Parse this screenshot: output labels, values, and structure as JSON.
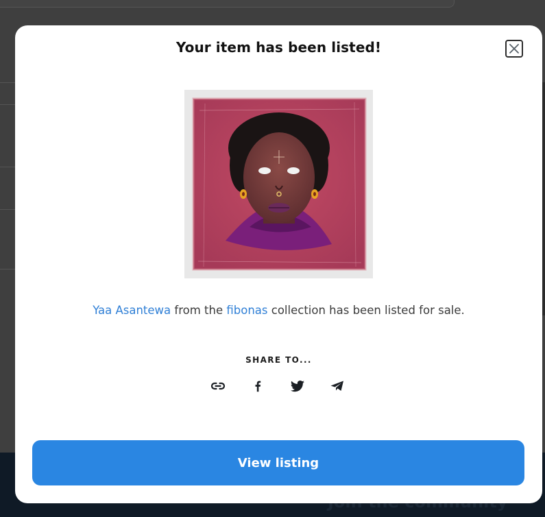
{
  "modal": {
    "title": "Your item has been listed!",
    "close_icon": "close-icon",
    "message": {
      "item_name": "Yaa Asantewa",
      "text_from": " from the ",
      "collection_name": "fibonas",
      "text_end": " collection has been listed for sale."
    },
    "share": {
      "label": "SHARE TO...",
      "options": [
        {
          "name": "copy-link",
          "icon": "link-icon"
        },
        {
          "name": "facebook",
          "icon": "facebook-icon"
        },
        {
          "name": "twitter",
          "icon": "twitter-icon"
        },
        {
          "name": "telegram",
          "icon": "telegram-icon"
        }
      ]
    },
    "view_button_label": "View listing",
    "colors": {
      "link": "#2f7fd6",
      "button": "#2a86e2",
      "overlay": "#3f3f3f",
      "artwork_background": "#b8455f"
    }
  },
  "background": {
    "footer_text": "Join the community"
  }
}
